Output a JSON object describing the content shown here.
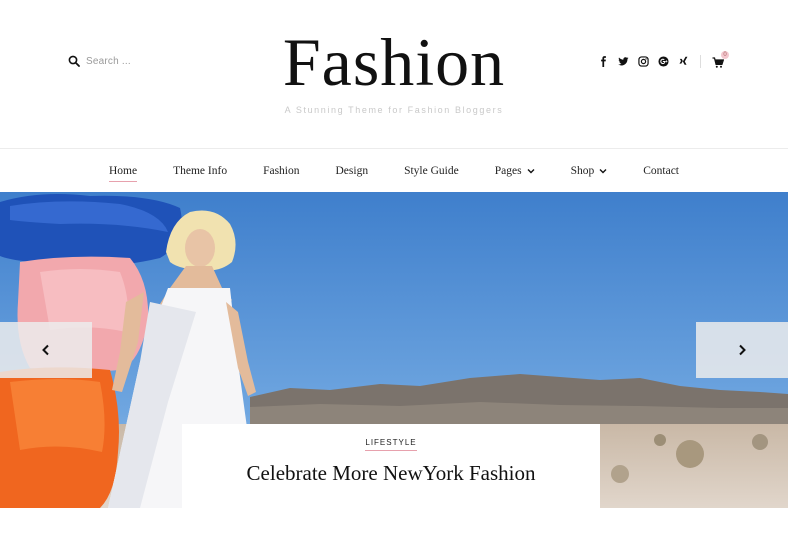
{
  "header": {
    "search_placeholder": "Search ...",
    "logo": "Fashion",
    "tagline": "A Stunning Theme for Fashion Bloggers",
    "socials": [
      "facebook-icon",
      "twitter-icon",
      "instagram-icon",
      "googleplus-icon",
      "xing-icon"
    ],
    "cart_count": "0"
  },
  "nav": {
    "items": [
      {
        "label": "Home",
        "active": true
      },
      {
        "label": "Theme Info"
      },
      {
        "label": "Fashion"
      },
      {
        "label": "Design"
      },
      {
        "label": "Style Guide"
      },
      {
        "label": "Pages",
        "dropdown": true
      },
      {
        "label": "Shop",
        "dropdown": true
      },
      {
        "label": "Contact"
      }
    ]
  },
  "slider": {
    "category": "LIFESTYLE",
    "title": "Celebrate More NewYork Fashion"
  },
  "colors": {
    "accent": "#e7a1ad",
    "sky": "#4a86cf",
    "text": "#111111"
  }
}
